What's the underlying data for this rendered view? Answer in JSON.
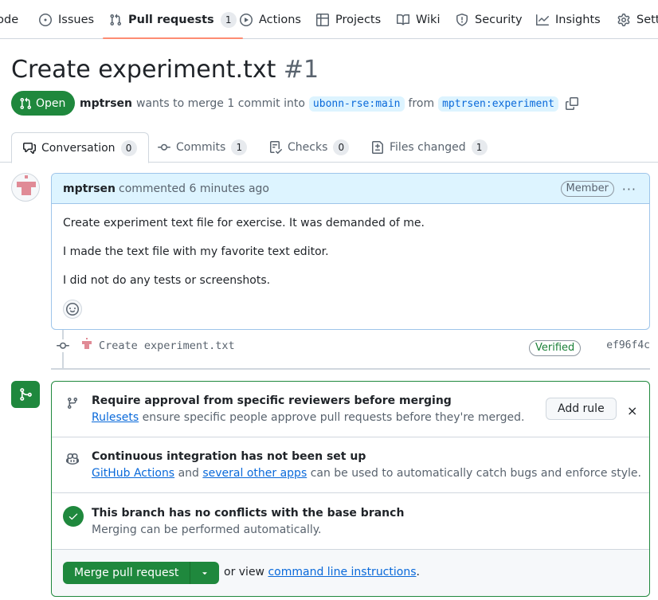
{
  "nav": {
    "items": [
      {
        "label": "Code",
        "icon": "code-icon"
      },
      {
        "label": "Issues",
        "icon": "issue-opened-icon"
      },
      {
        "label": "Pull requests",
        "icon": "git-pull-request-icon",
        "count": "1",
        "active": true
      },
      {
        "label": "Actions",
        "icon": "play-icon"
      },
      {
        "label": "Projects",
        "icon": "table-icon"
      },
      {
        "label": "Wiki",
        "icon": "book-icon"
      },
      {
        "label": "Security",
        "icon": "shield-icon"
      },
      {
        "label": "Insights",
        "icon": "graph-icon"
      },
      {
        "label": "Settings",
        "icon": "gear-icon"
      }
    ]
  },
  "pr": {
    "title": "Create experiment.txt",
    "number": "#1",
    "state": "Open",
    "author": "mptrsen",
    "meta_text": "wants to merge 1 commit into",
    "base_branch": "ubonn-rse:main",
    "from_text": "from",
    "head_branch": "mptrsen:experiment"
  },
  "tabs": [
    {
      "label": "Conversation",
      "count": "0",
      "icon": "comment-discussion-icon"
    },
    {
      "label": "Commits",
      "count": "1",
      "icon": "git-commit-icon"
    },
    {
      "label": "Checks",
      "count": "0",
      "icon": "checklist-icon"
    },
    {
      "label": "Files changed",
      "count": "1",
      "icon": "file-diff-icon"
    }
  ],
  "comment": {
    "author": "mptrsen",
    "action": "commented 6 minutes ago",
    "badge": "Member",
    "more": "···",
    "paragraphs": [
      "Create experiment text file for exercise. It was demanded of me.",
      "I made the text file with my favorite text editor.",
      "I did not do any tests or screenshots."
    ]
  },
  "commit": {
    "message": "Create experiment.txt",
    "verified": "Verified",
    "sha": "ef96f4c"
  },
  "merge": {
    "rules": {
      "title": "Require approval from specific reviewers before merging",
      "link": "Rulesets",
      "text": "ensure specific people approve pull requests before they're merged.",
      "button": "Add rule",
      "close": "×"
    },
    "ci": {
      "title": "Continuous integration has not been set up",
      "link1": "GitHub Actions",
      "and": "and",
      "link2": "several other apps",
      "text": "can be used to automatically catch bugs and enforce style."
    },
    "conflicts": {
      "title": "This branch has no conflicts with the base branch",
      "text": "Merging can be performed automatically."
    },
    "button": "Merge pull request",
    "or_view": "or view",
    "cli_link": "command line instructions",
    "period": "."
  },
  "colors": {
    "green": "#1f883d",
    "blue": "#0969da",
    "accent_underline": "#fd8c73"
  }
}
